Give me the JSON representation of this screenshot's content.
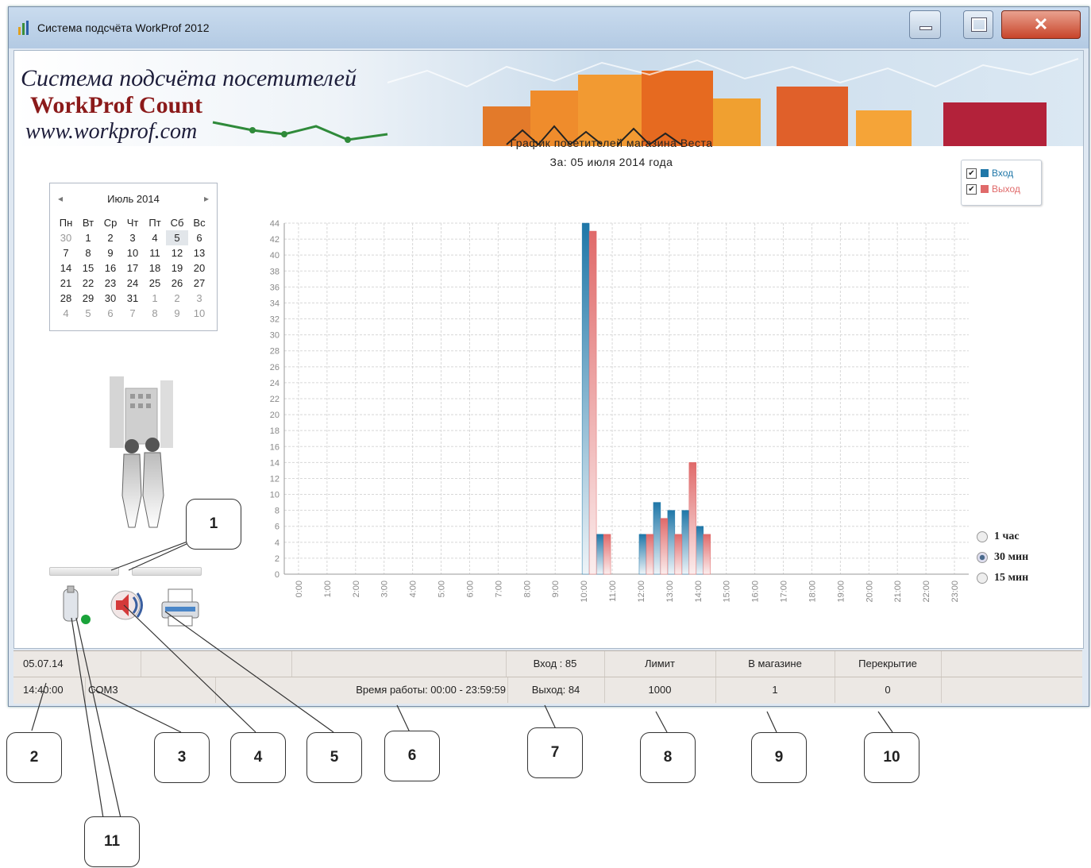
{
  "window": {
    "title": "Система подсчёта  WorkProf 2012"
  },
  "banner": {
    "line1": "Система подсчёта посетителей",
    "line2": "WorkProf Count",
    "line3": "www.workprof.com"
  },
  "calendar": {
    "month_label": "Июль 2014",
    "weekdays": [
      "Пн",
      "Вт",
      "Ср",
      "Чт",
      "Пт",
      "Сб",
      "Вс"
    ],
    "weeks": [
      [
        "30",
        "1",
        "2",
        "3",
        "4",
        "5",
        "6"
      ],
      [
        "7",
        "8",
        "9",
        "10",
        "11",
        "12",
        "13"
      ],
      [
        "14",
        "15",
        "16",
        "17",
        "18",
        "19",
        "20"
      ],
      [
        "21",
        "22",
        "23",
        "24",
        "25",
        "26",
        "27"
      ],
      [
        "28",
        "29",
        "30",
        "31",
        "1",
        "2",
        "3"
      ],
      [
        "4",
        "5",
        "6",
        "7",
        "8",
        "9",
        "10"
      ]
    ]
  },
  "chart_data": {
    "type": "bar",
    "title": "График посетителей магазина  Веста",
    "subtitle": "За:  05 июля 2014  года",
    "ylim": [
      0,
      44
    ],
    "yticks": [
      0,
      2,
      4,
      6,
      8,
      10,
      12,
      14,
      16,
      18,
      20,
      22,
      24,
      26,
      28,
      30,
      32,
      34,
      36,
      38,
      40,
      42,
      44
    ],
    "x_tick_labels": [
      "0:00",
      "1:00",
      "2:00",
      "3:00",
      "4:00",
      "5:00",
      "6:00",
      "7:00",
      "8:00",
      "9:00",
      "10:00",
      "11:00",
      "12:00",
      "13:00",
      "14:00",
      "15:00",
      "16:00",
      "17:00",
      "18:00",
      "19:00",
      "20:00",
      "21:00",
      "22:00",
      "23:00"
    ],
    "bin_minutes": 30,
    "series": [
      {
        "name": "Вход",
        "color": "#1f77a8",
        "bins": [
          {
            "start": "10:00",
            "value": 44
          },
          {
            "start": "10:30",
            "value": 5
          },
          {
            "start": "12:00",
            "value": 5
          },
          {
            "start": "12:30",
            "value": 9
          },
          {
            "start": "13:00",
            "value": 8
          },
          {
            "start": "13:30",
            "value": 8
          },
          {
            "start": "14:00",
            "value": 6
          }
        ]
      },
      {
        "name": "Выход",
        "color": "#e06a6a",
        "bins": [
          {
            "start": "10:00",
            "value": 43
          },
          {
            "start": "10:30",
            "value": 5
          },
          {
            "start": "12:00",
            "value": 5
          },
          {
            "start": "12:30",
            "value": 7
          },
          {
            "start": "13:00",
            "value": 5
          },
          {
            "start": "13:30",
            "value": 14
          },
          {
            "start": "14:00",
            "value": 5
          }
        ]
      }
    ]
  },
  "legend": {
    "in_label": "Вход",
    "out_label": "Выход"
  },
  "interval": {
    "options": [
      "1  час",
      "30 мин",
      "15 мин"
    ],
    "selected": "30 мин"
  },
  "status": {
    "row1": {
      "date": "05.07.14",
      "in": "Вход  : 85",
      "limit_header": "Лимит",
      "in_store_header": "В магазине",
      "overlap_header": "Перекрытие"
    },
    "row2": {
      "time": "14:40:00",
      "port": "COM3",
      "work_time": "Время работы:  00:00 - 23:59:59",
      "out": "Выход: 84",
      "limit_value": "1000",
      "in_store_value": "1",
      "overlap_value": "0"
    }
  },
  "callouts": [
    "1",
    "2",
    "3",
    "4",
    "5",
    "6",
    "7",
    "8",
    "9",
    "10",
    "11"
  ]
}
